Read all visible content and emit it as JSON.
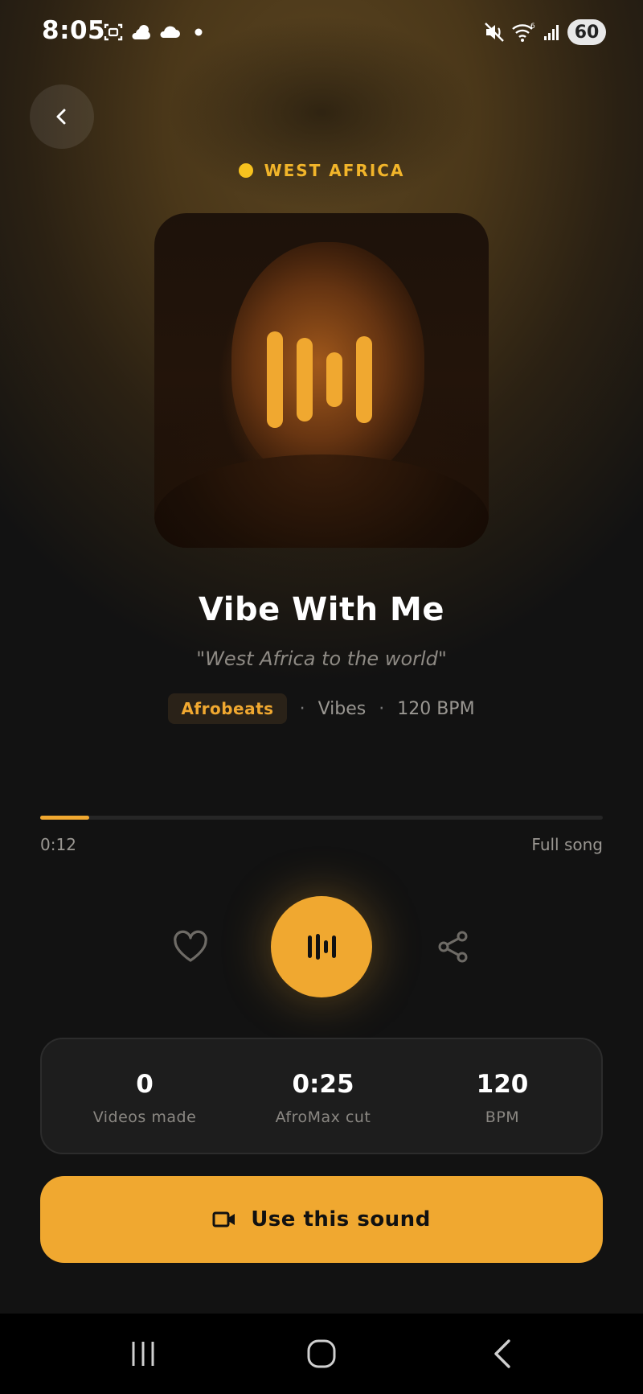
{
  "status_bar": {
    "time": "8:05",
    "battery": "60",
    "icons": [
      "screenshot-icon",
      "weather-icon",
      "cloud-icon",
      "dot-icon",
      "mute-icon",
      "wifi-icon",
      "signal-icon",
      "battery-icon"
    ]
  },
  "header": {
    "back_icon": "chevron-left-icon",
    "region": "WEST AFRICA",
    "region_dot_color": "#f7c21e"
  },
  "track": {
    "title": "Vibe With Me",
    "tagline": "\"West Africa to the world\"",
    "genre": "Afrobeats",
    "separator": "·",
    "mood": "Vibes",
    "bpm_text": "120 BPM"
  },
  "playback": {
    "elapsed": "0:12",
    "duration_label": "Full song",
    "progress": 0.087
  },
  "controls": {
    "like_icon": "heart-icon",
    "play_icon": "waveform-icon",
    "share_icon": "share-icon"
  },
  "stats": [
    {
      "value": "0",
      "label": "Videos made"
    },
    {
      "value": "0:25",
      "label": "AfroMax cut"
    },
    {
      "value": "120",
      "label": "BPM"
    }
  ],
  "cta": {
    "label": "Use this sound",
    "icon": "video-camera-icon"
  },
  "nav": {
    "recents_icon": "recents-icon",
    "home_icon": "home-icon",
    "back_icon": "back-icon"
  },
  "colors": {
    "accent": "#f0a830",
    "background": "#121212",
    "card": "#1d1d1d"
  }
}
